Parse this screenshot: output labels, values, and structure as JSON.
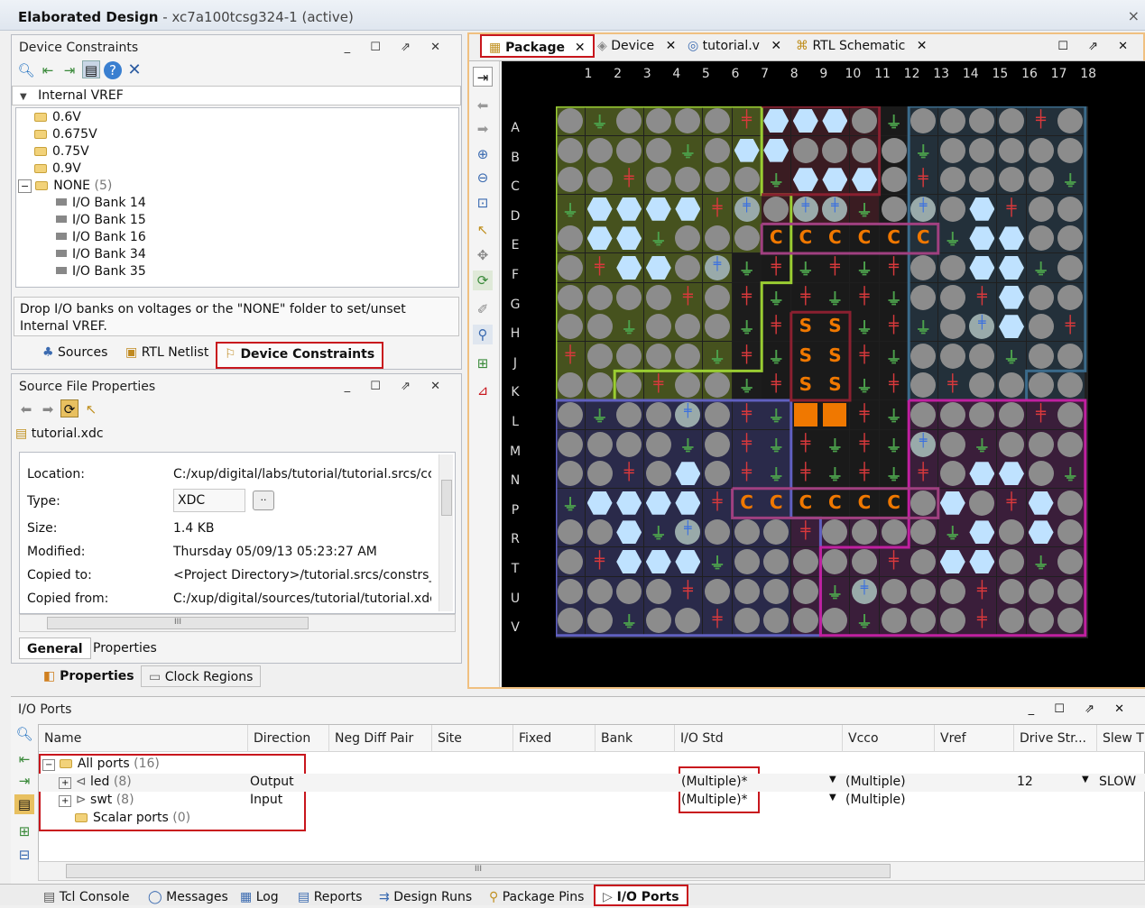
{
  "titlebar": {
    "title": "Elaborated Design",
    "subtitle": " - xc7a100tcsg324-1  (active)",
    "close": "×"
  },
  "device_constraints": {
    "title": "Device Constraints",
    "group": "Internal VREF",
    "items": [
      "0.6V",
      "0.675V",
      "0.75V",
      "0.9V"
    ],
    "none_label": "NONE",
    "none_count": "(5)",
    "banks": [
      "I/O Bank 14",
      "I/O Bank 15",
      "I/O Bank 16",
      "I/O Bank 34",
      "I/O Bank 35"
    ],
    "hint": "Drop I/O banks on voltages or the \"NONE\" folder to set/unset Internal VREF."
  },
  "left_tabs": {
    "sources": "Sources",
    "rtl_netlist": "RTL Netlist",
    "device_constraints": "Device Constraints"
  },
  "source_file_properties": {
    "title": "Source File Properties",
    "file": "tutorial.xdc",
    "props": [
      {
        "k": "Location:",
        "v": "C:/xup/digital/labs/tutorial/tutorial.srcs/cc"
      },
      {
        "k": "Type:",
        "v": "XDC"
      },
      {
        "k": "Size:",
        "v": "1.4 KB"
      },
      {
        "k": "Modified:",
        "v": "Thursday 05/09/13 05:23:27 AM"
      },
      {
        "k": "Copied to:",
        "v": "<Project Directory>/tutorial.srcs/constrs_"
      },
      {
        "k": "Copied from:",
        "v": "C:/xup/digital/sources/tutorial/tutorial.xdc"
      }
    ],
    "browse": "..",
    "scroll_mark": "III",
    "tabs": [
      "General",
      "Properties"
    ]
  },
  "bottom_left_tabs": {
    "properties": "Properties",
    "clock_regions": "Clock Regions"
  },
  "package_tabs": [
    {
      "label": "Package",
      "close": "✕"
    },
    {
      "label": "Device",
      "close": "✕"
    },
    {
      "label": "tutorial.v",
      "close": "✕"
    },
    {
      "label": "RTL Schematic",
      "close": "✕"
    }
  ],
  "package": {
    "columns": [
      "1",
      "2",
      "3",
      "4",
      "5",
      "6",
      "7",
      "8",
      "9",
      "10",
      "11",
      "12",
      "13",
      "14",
      "15",
      "16",
      "17",
      "18"
    ],
    "rows": [
      "A",
      "B",
      "C",
      "D",
      "E",
      "F",
      "G",
      "H",
      "J",
      "K",
      "L",
      "M",
      "N",
      "P",
      "R",
      "T",
      "U",
      "V"
    ],
    "letters": {
      "c": "C",
      "s": "S"
    }
  },
  "io_ports": {
    "title": "I/O Ports",
    "headers": [
      "Name",
      "Direction",
      "Neg Diff Pair",
      "Site",
      "Fixed",
      "Bank",
      "I/O Std",
      "Vcco",
      "Vref",
      "Drive Str...",
      "Slew T"
    ],
    "all_ports": "All ports",
    "all_count": "(16)",
    "rows": [
      {
        "name": "led",
        "count": "(8)",
        "direction": "Output",
        "iostd": "(Multiple)*",
        "vcco": "(Multiple)",
        "drive": "12",
        "slew": "SLOW"
      },
      {
        "name": "swt",
        "count": "(8)",
        "direction": "Input",
        "iostd": "(Multiple)*",
        "vcco": "(Multiple)",
        "drive": "",
        "slew": ""
      }
    ],
    "scalar": "Scalar ports",
    "scalar_count": "(0)",
    "scroll_mark": "III"
  },
  "bottom_tabs": [
    "Tcl Console",
    "Messages",
    "Log",
    "Reports",
    "Design Runs",
    "Package Pins",
    "I/O Ports"
  ]
}
